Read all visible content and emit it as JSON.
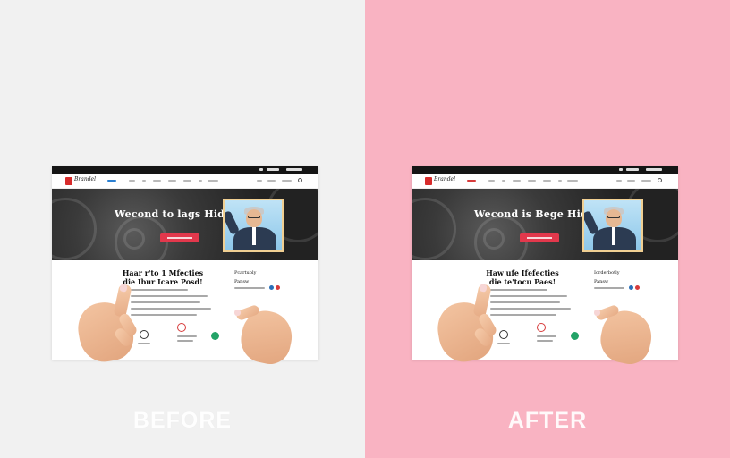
{
  "panels": [
    {
      "id": "before",
      "label": "BEFORE",
      "background": "#f1f1f1",
      "mockup": {
        "logo_text": "Brandel",
        "hero_title": "Wecond to lags Hides",
        "content_title_line1": "Haar r'to 1 Mfecties",
        "content_title_line2": "die Ibur Icare Posd!",
        "side_heading": "Pcartubly",
        "side_label": "Pansw"
      }
    },
    {
      "id": "after",
      "label": "AFTER",
      "background": "#f9b3c2",
      "mockup": {
        "logo_text": "Brandel",
        "hero_title": "Wecond is Bege Hides",
        "content_title_line1": "Haw ufe Ifefecties",
        "content_title_line2": "die te'tocu Paes!",
        "side_heading": "Iorderbotly",
        "side_label": "Pansw"
      }
    }
  ],
  "colors": {
    "hero_button": "#e2384c",
    "logo_mark": "#d72b2b",
    "nav_active_before": "#2a7fd1",
    "nav_active_after": "#d73b3b"
  },
  "icons": [
    "hand-left",
    "hand-right",
    "gear-bg",
    "social-dot"
  ]
}
